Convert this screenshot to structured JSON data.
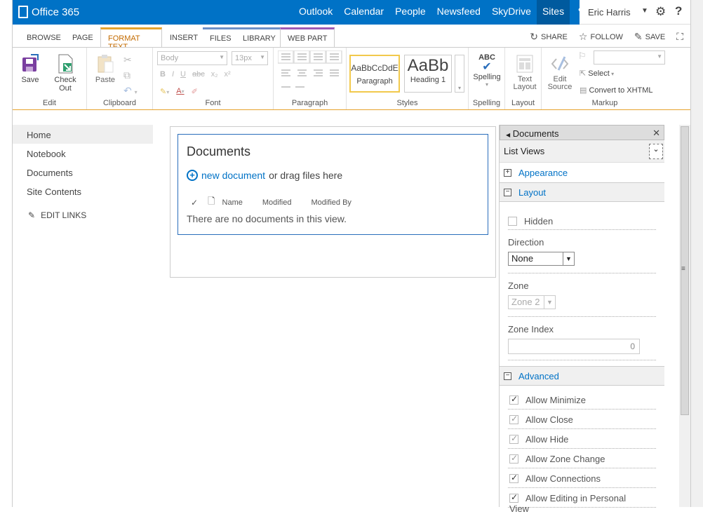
{
  "suitebar": {
    "brand": "Office 365",
    "nav": [
      "Outlook",
      "Calendar",
      "People",
      "Newsfeed",
      "SkyDrive",
      "Sites"
    ],
    "active_nav": "Sites",
    "more": "•••",
    "user": "Eric Harris",
    "colors": {
      "bar": "#0072c6",
      "active": "#005a9e"
    }
  },
  "tabs": [
    "BROWSE",
    "PAGE",
    "FORMAT TEXT",
    "INSERT",
    "FILES",
    "LIBRARY",
    "WEB PART"
  ],
  "actions": {
    "share": "SHARE",
    "follow": "FOLLOW",
    "save": "SAVE"
  },
  "ribbon": {
    "edit": {
      "save": "Save",
      "checkout": "Check Out",
      "label": "Edit"
    },
    "clipboard": {
      "paste": "Paste",
      "label": "Clipboard"
    },
    "font": {
      "family": "Body",
      "size": "13px",
      "label": "Font",
      "buttons": [
        "B",
        "I",
        "U",
        "abc",
        "x₂",
        "x²"
      ]
    },
    "paragraph": {
      "label": "Paragraph"
    },
    "styles": {
      "paragraph_sample": "AaBbCcDdE",
      "paragraph_name": "Paragraph",
      "heading_sample": "AaBb",
      "heading_name": "Heading 1",
      "label": "Styles"
    },
    "spelling": {
      "icon_text": "ABC",
      "button": "Spelling",
      "label": "Spelling"
    },
    "layout": {
      "button_line1": "Text",
      "button_line2": "Layout",
      "label": "Layout"
    },
    "markup": {
      "edit_line1": "Edit",
      "edit_line2": "Source",
      "select": "Select",
      "convert": "Convert to XHTML",
      "label": "Markup"
    }
  },
  "leftnav": {
    "items": [
      "Home",
      "Notebook",
      "Documents",
      "Site Contents"
    ],
    "active": "Home",
    "edit_links": "EDIT LINKS"
  },
  "webpart": {
    "title": "Documents",
    "new_document": "new document",
    "drag_text": "or drag files here",
    "columns": [
      "Name",
      "Modified",
      "Modified By"
    ],
    "empty": "There are no documents in this view."
  },
  "toolpane": {
    "title": "Documents",
    "views": "List Views",
    "appearance": "Appearance",
    "layout": "Layout",
    "hidden": "Hidden",
    "direction_label": "Direction",
    "direction_value": "None",
    "zone_label": "Zone",
    "zone_value": "Zone 2",
    "zone_index_label": "Zone Index",
    "zone_index_value": "0",
    "advanced": "Advanced",
    "advanced_items": [
      {
        "label": "Allow Minimize",
        "checked": true,
        "enabled": true
      },
      {
        "label": "Allow Close",
        "checked": true,
        "enabled": false
      },
      {
        "label": "Allow Hide",
        "checked": true,
        "enabled": false
      },
      {
        "label": "Allow Zone Change",
        "checked": true,
        "enabled": false
      },
      {
        "label": "Allow Connections",
        "checked": true,
        "enabled": true
      },
      {
        "label": "Allow Editing in Personal View",
        "checked": true,
        "enabled": true
      }
    ]
  }
}
